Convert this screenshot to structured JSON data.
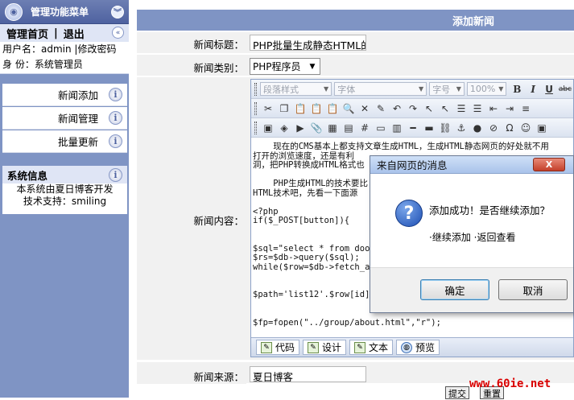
{
  "sidebar": {
    "header_title": "管理功能菜单",
    "home_link": "管理首页",
    "separator": "|",
    "logout_link": "退出",
    "username_line": "用户名：admin |修改密码",
    "identity_line": "身  份：系统管理员",
    "menu_items": [
      {
        "label": "新闻添加"
      },
      {
        "label": "新闻管理"
      },
      {
        "label": "批量更新"
      }
    ],
    "sysinfo_title": "系统信息",
    "sysinfo_line1": "本系统由夏日博客开发",
    "sysinfo_line2": "技术支持：smiling"
  },
  "main": {
    "page_title": "添加新闻",
    "labels": {
      "title": "新闻标题：",
      "category": "新闻类别：",
      "content": "新闻内容：",
      "source": "新闻来源："
    },
    "title_value": "PHP批量生成静态HTML的",
    "category_value": "PHP程序员",
    "source_value": "夏日博客",
    "editor": {
      "style_dd": "段落样式",
      "font_dd": "字体",
      "size_dd": "字号",
      "zoom_dd": "100%",
      "content_lines": [
        "    现在的CMS基本上都支持文章生成HTML，生成HTML静态网页的好处就不用",
        "打开的浏览速度，还是有利",
        "洞，把PHP转换成HTML格式也",
        "",
        "    PHP生成HTML的技术要比",
        "HTML技术吧，先看一下面源",
        "",
        "<?php",
        "if($_POST[button]){",
        "",
        "",
        "$sql=\"select * from door",
        "$rs=$db->query($sql);",
        "while($row=$db->fetch_ar",
        "",
        "",
        "$path='list12'.$row[id].",
        "",
        "",
        "$fp=fopen(\"../group/about.html\",\"r\");"
      ],
      "modes": [
        "代码",
        "设计",
        "文本",
        "预览"
      ]
    },
    "submit_label": "提交",
    "reset_label": "重置"
  },
  "dialog": {
    "title": "来自网页的消息",
    "close_label": "X",
    "message": "添加成功！是否继续添加？",
    "options": "·继续添加  ·返回查看",
    "ok_label": "确定",
    "cancel_label": "取消"
  },
  "watermark": "www.60ie.net"
}
